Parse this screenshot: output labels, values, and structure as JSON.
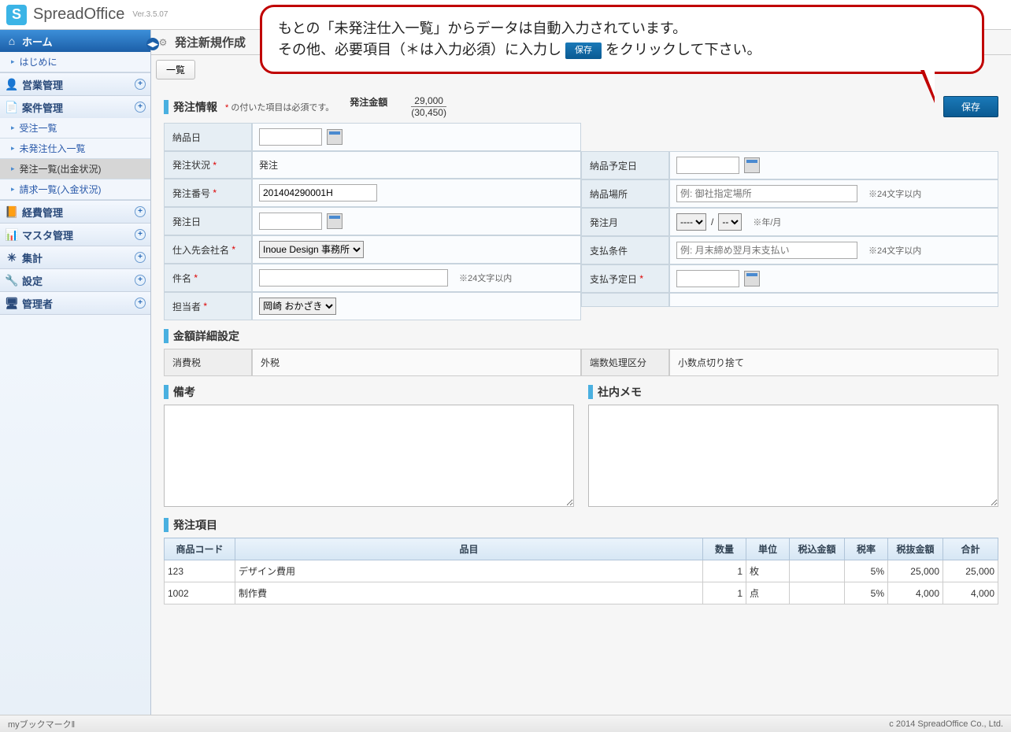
{
  "app": {
    "name": "SpreadOffice",
    "version": "Ver.3.5.07"
  },
  "callout": {
    "line1": "もとの「未発注仕入一覧」からデータは自動入力されています。",
    "line2a": "その他、必要項目（＊は入力必須）に入力し",
    "save_mini": "保存",
    "line2b": "をクリックして下さい。"
  },
  "sidebar": {
    "home": "ホーム",
    "hajimeni": "はじめに",
    "groups": [
      {
        "label": "営業管理"
      },
      {
        "label": "案件管理",
        "items": [
          "受注一覧",
          "未発注仕入一覧",
          "発注一覧(出金状況)",
          "請求一覧(入金状況)"
        ],
        "active_index": 2
      },
      {
        "label": "経費管理"
      },
      {
        "label": "マスタ管理"
      },
      {
        "label": "集計"
      },
      {
        "label": "設定"
      },
      {
        "label": "管理者"
      }
    ]
  },
  "page": {
    "title": "発注新規作成",
    "list_btn": "一覧",
    "info_section": "発注情報",
    "info_note_prefix": "* ",
    "info_note": "の付いた項目は必須です。",
    "amount_label": "発注金額",
    "amount_main": "29,000",
    "amount_sub": "(30,450)",
    "save": "保存"
  },
  "form": {
    "noukinbi": "納品日",
    "hacchu_jokyo": "発注状況",
    "hacchu_jokyo_val": "発注",
    "noukin_yotei": "納品予定日",
    "hacchu_bango": "発注番号",
    "hacchu_bango_val": "201404290001H",
    "noukin_basho": "納品場所",
    "noukin_basho_ph": "例: 御社指定場所",
    "limit24": "※24文字以内",
    "hacchu_bi": "発注日",
    "hacchu_tsuki": "発注月",
    "year_sel": "----",
    "month_sel": "--",
    "ym_note": "※年/月",
    "shiire": "仕入先会社名",
    "shiire_val": "Inoue Design 事務所",
    "shiharai_joken": "支払条件",
    "shiharai_joken_ph": "例: 月末締め翌月末支払い",
    "kenmei": "件名",
    "shiharai_yotei": "支払予定日",
    "tantou": "担当者",
    "tantou_val": "岡崎 おかざき"
  },
  "detail_section": "金額詳細設定",
  "detail": {
    "shouhizei_l": "消費税",
    "shouhizei_v": "外税",
    "hasu_l": "端数処理区分",
    "hasu_v": "小数点切り捨て"
  },
  "memo": {
    "bikou": "備考",
    "shanai": "社内メモ"
  },
  "items_section": "発注項目",
  "items": {
    "headers": [
      "商品コード",
      "品目",
      "数量",
      "単位",
      "税込金額",
      "税率",
      "税抜金額",
      "合計"
    ],
    "rows": [
      {
        "code": "123",
        "name": "デザイン費用",
        "qty": "1",
        "unit": "枚",
        "incl": "",
        "rate": "5%",
        "excl": "25,000",
        "total": "25,000"
      },
      {
        "code": "1002",
        "name": "制作費",
        "qty": "1",
        "unit": "点",
        "incl": "",
        "rate": "5%",
        "excl": "4,000",
        "total": "4,000"
      }
    ]
  },
  "footer": {
    "bookmark": "myブックマーク‖",
    "copyright": "c 2014 SpreadOffice Co., Ltd."
  }
}
